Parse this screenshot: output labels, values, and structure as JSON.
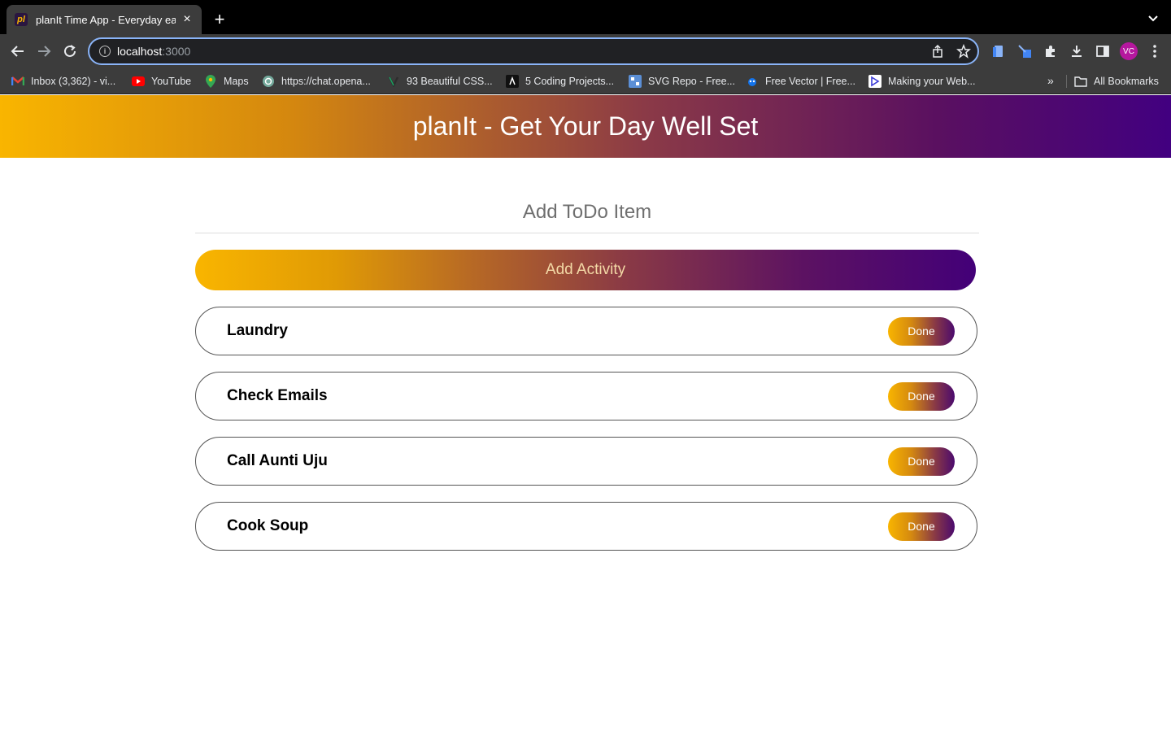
{
  "browser": {
    "tab_title": "planIt Time App - Everyday eas",
    "favicon_text": "pl",
    "url_host": "localhost",
    "url_port": ":3000",
    "avatar_initials": "VC",
    "bookmarks": [
      {
        "label": "Inbox (3,362) - vi...",
        "icon": "gmail-icon"
      },
      {
        "label": "YouTube",
        "icon": "youtube-icon"
      },
      {
        "label": "Maps",
        "icon": "maps-icon"
      },
      {
        "label": "https://chat.opena...",
        "icon": "chatgpt-icon"
      },
      {
        "label": "93 Beautiful CSS...",
        "icon": "css-icon"
      },
      {
        "label": "5 Coding Projects...",
        "icon": "coding-icon"
      },
      {
        "label": "SVG Repo - Free...",
        "icon": "svgrepo-icon"
      },
      {
        "label": "Free Vector | Free...",
        "icon": "freepik-icon"
      },
      {
        "label": "Making your Web...",
        "icon": "web-icon"
      }
    ],
    "bookmarks_overflow": "»",
    "all_bookmarks": "All Bookmarks"
  },
  "header": {
    "title": "planIt - Get Your Day Well Set"
  },
  "form": {
    "placeholder": "Add ToDo Item",
    "value": "",
    "add_button": "Add Activity"
  },
  "todos": [
    {
      "text": "Laundry",
      "button": "Done"
    },
    {
      "text": "Check Emails",
      "button": "Done"
    },
    {
      "text": "Call Aunti Uju",
      "button": "Done"
    },
    {
      "text": "Cook Soup",
      "button": "Done"
    }
  ],
  "colors": {
    "gradient_start": "#f9b500",
    "gradient_end": "#420080",
    "omnibox_border": "#8ab4f8"
  }
}
